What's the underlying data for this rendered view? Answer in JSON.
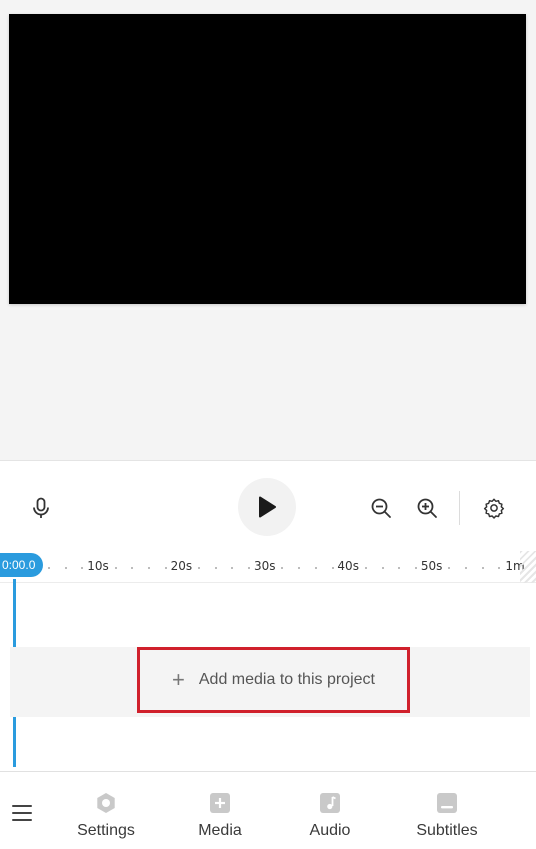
{
  "controls": {
    "mic_icon": "microphone-icon",
    "play_icon": "play-icon",
    "zoom_out_icon": "zoom-out-icon",
    "zoom_in_icon": "zoom-in-icon",
    "settings_icon": "gear-icon"
  },
  "timeline": {
    "playhead_time": "0:00.0",
    "ticks": [
      "10s",
      "20s",
      "30s",
      "40s",
      "50s",
      "1m"
    ],
    "accent_color": "#2a9bde"
  },
  "track": {
    "add_media_label": "Add media to this project",
    "add_media_icon": "plus-icon",
    "highlight_color": "#d0202c"
  },
  "bottom_nav": {
    "menu_icon": "hamburger-menu-icon",
    "tabs": [
      {
        "label": "Settings",
        "icon": "settings-hexagon-icon"
      },
      {
        "label": "Media",
        "icon": "media-plus-icon"
      },
      {
        "label": "Audio",
        "icon": "music-note-icon"
      },
      {
        "label": "Subtitles",
        "icon": "subtitles-icon"
      }
    ]
  }
}
